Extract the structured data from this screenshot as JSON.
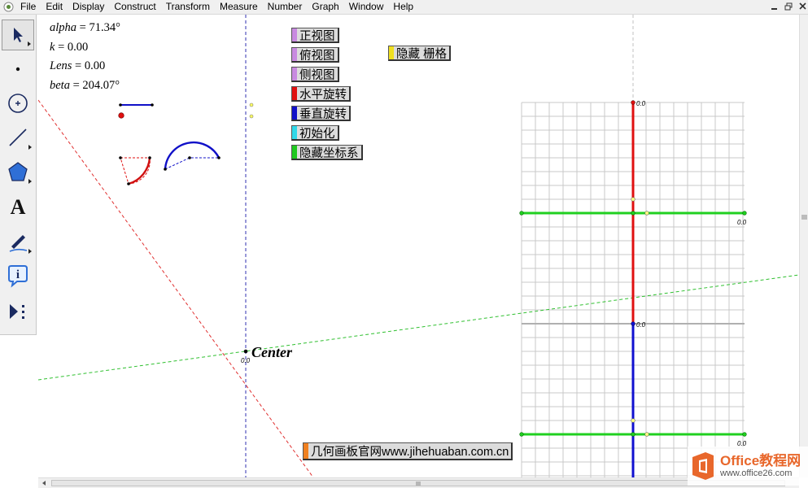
{
  "menubar": {
    "items": [
      "File",
      "Edit",
      "Display",
      "Construct",
      "Transform",
      "Measure",
      "Number",
      "Graph",
      "Window",
      "Help"
    ]
  },
  "window_controls": [
    "minimize",
    "restore",
    "close"
  ],
  "toolbox": {
    "tools": [
      {
        "name": "selection-arrow-tool-icon"
      },
      {
        "name": "point-tool-icon"
      },
      {
        "name": "compass-tool-icon"
      },
      {
        "name": "straightedge-tool-icon"
      },
      {
        "name": "polygon-tool-icon"
      },
      {
        "name": "text-tool-icon",
        "glyph": "A"
      },
      {
        "name": "marker-tool-icon"
      },
      {
        "name": "information-tool-icon",
        "glyph": "i"
      },
      {
        "name": "custom-tool-icon"
      }
    ]
  },
  "measurements": [
    {
      "var": "alpha",
      "text": " = 71.34°"
    },
    {
      "var": "k",
      "text": " = 0.00"
    },
    {
      "var": "Lens",
      "text": " = 0.00"
    },
    {
      "var": "beta",
      "text": " = 204.07°"
    }
  ],
  "buttons": [
    {
      "label": "正视图",
      "color": "#c88ae0"
    },
    {
      "label": "俯视图",
      "color": "#c88ae0"
    },
    {
      "label": "侧视图",
      "color": "#c88ae0"
    },
    {
      "label": "水平旋转",
      "color": "#e01010"
    },
    {
      "label": "垂直旋转",
      "color": "#1010c8"
    },
    {
      "label": "初始化",
      "color": "#30d8e8"
    },
    {
      "label": "隐藏坐标系",
      "color": "#20c820"
    },
    {
      "label": "隐藏 栅格",
      "color": "#f0e020"
    }
  ],
  "canvas": {
    "center_label": "Center",
    "center_value": "0.0",
    "axis_values": [
      "0.0",
      "0.0",
      "0.0",
      "0.0"
    ],
    "website_label": "几何画板官网www.jihehuaban.com.cn",
    "website_color": "#f08020",
    "colors": {
      "red_axis": "#e01010",
      "blue_axis": "#1010d0",
      "green_axis": "#20d020",
      "grid": "#c8c8c8"
    }
  },
  "watermark": {
    "text1": "Office教程网",
    "text2": "www.office26.com"
  }
}
